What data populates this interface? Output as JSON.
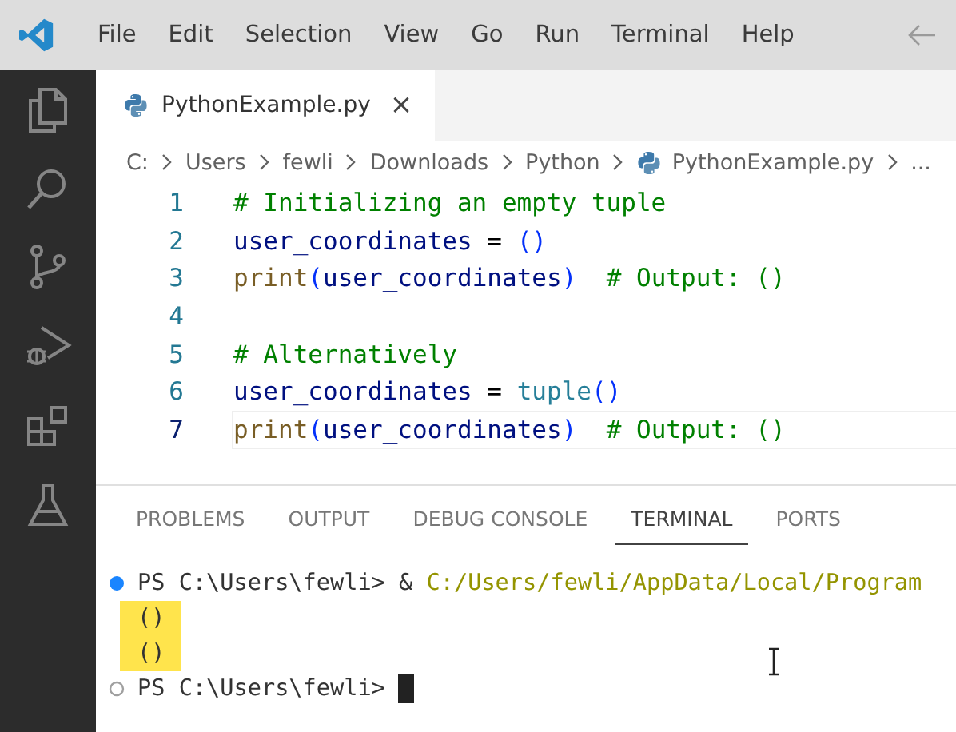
{
  "menu": {
    "items": [
      "File",
      "Edit",
      "Selection",
      "View",
      "Go",
      "Run",
      "Terminal",
      "Help"
    ]
  },
  "activity_bar": {
    "items": [
      {
        "kind": "explorer"
      },
      {
        "kind": "search"
      },
      {
        "kind": "source-control"
      },
      {
        "kind": "run-debug"
      },
      {
        "kind": "extensions"
      },
      {
        "kind": "testing"
      }
    ]
  },
  "tabs": [
    {
      "label": "PythonExample.py",
      "selected": true,
      "close": "×"
    }
  ],
  "breadcrumb": [
    {
      "label": "C:",
      "kind": "folder"
    },
    {
      "label": "Users",
      "kind": "folder"
    },
    {
      "label": "fewli",
      "kind": "folder"
    },
    {
      "label": "Downloads",
      "kind": "folder"
    },
    {
      "label": "Python",
      "kind": "folder"
    },
    {
      "label": "PythonExample.py",
      "kind": "file"
    },
    {
      "label": "...",
      "kind": "more"
    }
  ],
  "editor": {
    "lines": [
      {
        "number": "1",
        "current": false,
        "tokens": [
          {
            "kind": "comment",
            "text": "# Initializing an empty tuple"
          }
        ]
      },
      {
        "number": "2",
        "current": false,
        "tokens": [
          {
            "kind": "variable",
            "text": "user_coordinates"
          },
          {
            "kind": "plain",
            "text": " = "
          },
          {
            "kind": "bracket",
            "text": "()"
          }
        ]
      },
      {
        "number": "3",
        "current": false,
        "tokens": [
          {
            "kind": "function",
            "text": "print"
          },
          {
            "kind": "bracket",
            "text": "("
          },
          {
            "kind": "variable",
            "text": "user_coordinates"
          },
          {
            "kind": "bracket",
            "text": ")"
          },
          {
            "kind": "trailing-comment",
            "text": "# Output: ()"
          }
        ]
      },
      {
        "number": "4",
        "current": false
      },
      {
        "number": "5",
        "current": false,
        "tokens": [
          {
            "kind": "comment",
            "text": "# Alternatively"
          }
        ]
      },
      {
        "number": "6",
        "current": false,
        "tokens": [
          {
            "kind": "variable",
            "text": "user_coordinates"
          },
          {
            "kind": "plain",
            "text": " = "
          },
          {
            "kind": "builtin",
            "text": "tuple"
          },
          {
            "kind": "bracket",
            "text": "()"
          }
        ]
      },
      {
        "number": "7",
        "current": true,
        "tokens": [
          {
            "kind": "function",
            "text": "print"
          },
          {
            "kind": "bracket",
            "text": "("
          },
          {
            "kind": "variable",
            "text": "user_coordinates"
          },
          {
            "kind": "bracket",
            "text": ")"
          },
          {
            "kind": "trailing-comment",
            "text": "# Output: ()"
          }
        ]
      }
    ]
  },
  "panel": {
    "tabs": [
      {
        "label": "PROBLEMS",
        "selected": false
      },
      {
        "label": "OUTPUT",
        "selected": false
      },
      {
        "label": "DEBUG CONSOLE",
        "selected": false
      },
      {
        "label": "TERMINAL",
        "selected": true
      },
      {
        "label": "PORTS",
        "selected": false
      }
    ],
    "terminal": [
      {
        "kind": "prompt",
        "finished": true,
        "prompt": "PS C:\\Users\\fewli>",
        "command": "&",
        "path": "C:/Users/fewli/AppData/Local/Program"
      },
      {
        "kind": "output",
        "text": "()",
        "highlighted": true
      },
      {
        "kind": "output",
        "text": "()",
        "highlighted": true
      },
      {
        "kind": "prompt",
        "finished": false,
        "prompt": "PS C:\\Users\\fewli>",
        "cursor": true
      }
    ]
  }
}
